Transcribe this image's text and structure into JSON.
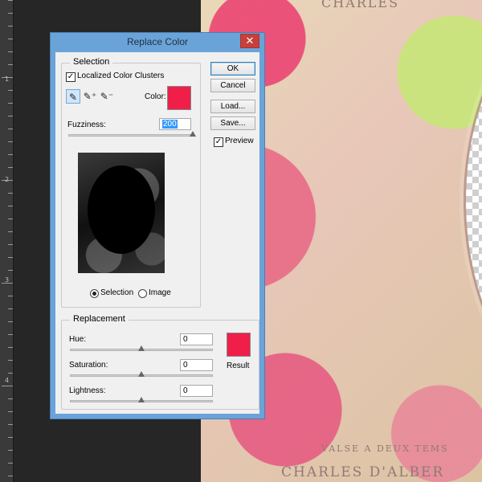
{
  "ruler": {
    "marks": [
      "1",
      "2",
      "3",
      "4"
    ]
  },
  "canvas": {
    "top_text": "CHARLES",
    "middle_text": "VALSE A DEUX TEMS",
    "bottom_text": "CHARLES D'ALBER"
  },
  "dialog": {
    "title": "Replace Color",
    "close_glyph": "✕",
    "selection": {
      "legend": "Selection",
      "localized_label": "Localized Color Clusters",
      "localized_checked": true,
      "color_label": "Color:",
      "color_value": "#ef1f4a",
      "fuzziness_label": "Fuzziness:",
      "fuzziness_value": "200",
      "fuzziness_fraction": 1.0,
      "radio_selection": "Selection",
      "radio_image": "Image"
    },
    "buttons": {
      "ok": "OK",
      "cancel": "Cancel",
      "load": "Load...",
      "save": "Save..."
    },
    "preview_label": "Preview",
    "preview_checked": true,
    "replacement": {
      "legend": "Replacement",
      "hue_label": "Hue:",
      "hue_value": "0",
      "hue_fraction": 0.5,
      "saturation_label": "Saturation:",
      "saturation_value": "0",
      "saturation_fraction": 0.5,
      "lightness_label": "Lightness:",
      "lightness_value": "0",
      "lightness_fraction": 0.5,
      "result_label": "Result",
      "result_color": "#ef1f4a"
    }
  },
  "colors": {
    "dialog_frame": "#6aa3d8",
    "close_button": "#c7403a"
  }
}
